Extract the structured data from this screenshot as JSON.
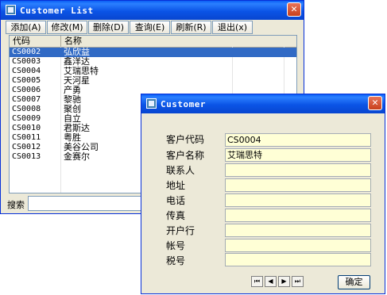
{
  "list_window": {
    "title": "Customer List",
    "toolbar": [
      {
        "label": "添加(A)"
      },
      {
        "label": "修改(M)"
      },
      {
        "label": "删除(D)"
      },
      {
        "label": "查询(E)"
      },
      {
        "label": "刷新(R)"
      },
      {
        "label": "退出(x)"
      }
    ],
    "columns": [
      "代码",
      "名称"
    ],
    "rows": [
      {
        "code": "CS0002",
        "name": "弘欣益",
        "selected": true
      },
      {
        "code": "CS0003",
        "name": "鑫洋达"
      },
      {
        "code": "CS0004",
        "name": "艾瑞思特"
      },
      {
        "code": "CS0005",
        "name": "天河星"
      },
      {
        "code": "CS0006",
        "name": "产勇"
      },
      {
        "code": "CS0007",
        "name": "黎驰"
      },
      {
        "code": "CS0008",
        "name": "聚创"
      },
      {
        "code": "CS0009",
        "name": "自立"
      },
      {
        "code": "CS0010",
        "name": "君斯达"
      },
      {
        "code": "CS0011",
        "name": "粤胜"
      },
      {
        "code": "CS0012",
        "name": "美谷公司"
      },
      {
        "code": "CS0013",
        "name": "金赛尔"
      }
    ],
    "search_label": "搜索",
    "search_value": ""
  },
  "detail_window": {
    "title": "Customer",
    "fields": [
      {
        "label": "客户代码",
        "value": "CS0004"
      },
      {
        "label": "客户名称",
        "value": "艾瑞思特"
      },
      {
        "label": "联系人",
        "value": ""
      },
      {
        "label": "地址",
        "value": ""
      },
      {
        "label": "电话",
        "value": ""
      },
      {
        "label": "传真",
        "value": ""
      },
      {
        "label": "开户行",
        "value": ""
      },
      {
        "label": "帐号",
        "value": ""
      },
      {
        "label": "税号",
        "value": ""
      }
    ],
    "nav": {
      "first": "⏮",
      "prev": "◀",
      "next": "▶",
      "last": "⏭"
    },
    "ok_label": "确定"
  },
  "icons": {
    "close": "close-icon",
    "app": "app-icon"
  },
  "colors": {
    "titlebar": "#0b54e6",
    "selection": "#316ac5",
    "field_bg": "#ffffd6"
  }
}
